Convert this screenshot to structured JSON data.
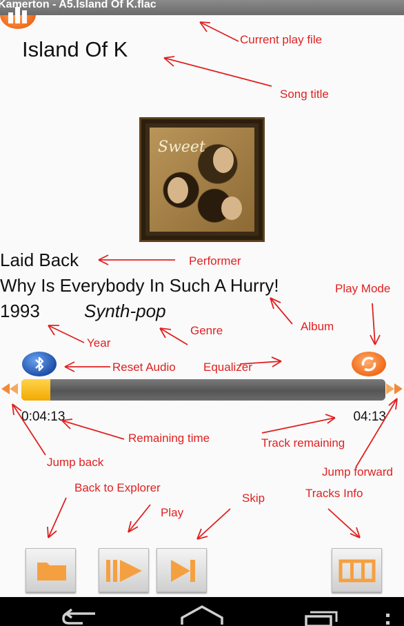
{
  "titlebar": {
    "text": "Kamerton - A5.Island Of K.flac"
  },
  "player": {
    "song_title": "Island Of K",
    "performer": "Laid Back",
    "album": "Why Is Everybody In Such A Hurry!",
    "year": "1993",
    "genre": "Synth-pop",
    "elapsed": "0:04:13",
    "remaining": "04:13",
    "progress_fraction": 0.08
  },
  "annotations": {
    "current_play_file": "Current play file",
    "song_title": "Song title",
    "performer": "Performer",
    "play_mode": "Play Mode",
    "album": "Album",
    "genre": "Genre",
    "year": "Year",
    "reset_audio": "Reset Audio",
    "equalizer": "Equalizer",
    "remaining_time": "Remaining time",
    "track_remaining": "Track remaining",
    "jump_back": "Jump back",
    "jump_forward": "Jump forward",
    "back_to_explorer": "Back to Explorer",
    "skip": "Skip",
    "play": "Play",
    "tracks_info": "Tracks Info"
  },
  "icons": {
    "reset_audio": "bluetooth-icon",
    "equalizer": "equalizer-icon",
    "play_mode": "repeat-icon",
    "jump_back": "rewind-icon",
    "jump_forward": "fast-forward-icon",
    "explorer": "folder-icon",
    "play": "play-pause-icon",
    "skip": "skip-next-icon",
    "tracks_info": "film-strip-icon",
    "nav_back": "back-icon",
    "nav_home": "home-icon",
    "nav_recents": "recents-icon",
    "nav_menu": "overflow-menu-icon"
  },
  "colors": {
    "accent": "#f06a18",
    "annotation": "#e02020",
    "progress_fill": "#f2a900",
    "bluetooth": "#1d4fa8"
  }
}
